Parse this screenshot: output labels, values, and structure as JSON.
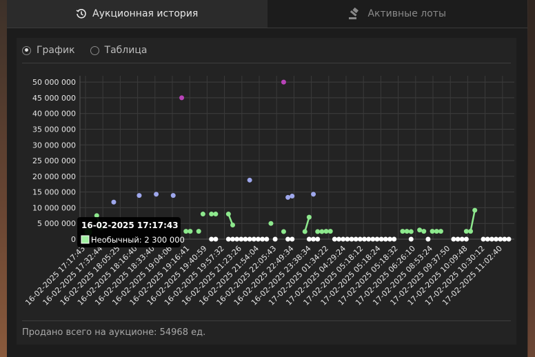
{
  "tabs": [
    {
      "label": "Аукционная история",
      "icon": "history-icon",
      "active": true
    },
    {
      "label": "Активные лоты",
      "icon": "gavel-icon",
      "active": false
    }
  ],
  "view_options": [
    {
      "label": "График",
      "selected": true
    },
    {
      "label": "Таблица",
      "selected": false
    }
  ],
  "footer": {
    "total_sold": "Продано всего на аукционе: 54968 ед."
  },
  "tooltip": {
    "title": "16-02-2025 17:17:43",
    "line": "Необычный: 2 300 000",
    "swatch_color": "#a0f0a0"
  },
  "colors": {
    "common": "#ffffff",
    "uncommon": "#8de88d",
    "rare": "#9ea7ec",
    "epic": "#b843b8"
  },
  "chart_data": {
    "type": "scatter",
    "title": "",
    "xlabel": "",
    "ylabel": "",
    "ylim": [
      0,
      52000000
    ],
    "yticks": [
      0,
      5000000,
      10000000,
      15000000,
      20000000,
      25000000,
      30000000,
      35000000,
      40000000,
      45000000,
      50000000
    ],
    "ytick_labels": [
      "0",
      "5 000 000",
      "10 000 000",
      "15 000 000",
      "20 000 000",
      "25 000 000",
      "30 000 000",
      "35 000 000",
      "40 000 000",
      "45 000 000",
      "50 000 000"
    ],
    "x_labels": [
      "16-02-2025 17:17:43",
      "16-02-2025 17:32:44",
      "16-02-2025 18:05:25",
      "16-02-2025 18:16:40",
      "16-02-2025 18:33:40",
      "16-02-2025 19:04:06",
      "16-02-2025 19:16:41",
      "16-02-2025 19:40:59",
      "16-02-2025 19:57:32",
      "16-02-2025 21:23:26",
      "16-02-2025 21:54:04",
      "16-02-2025 22:05:43",
      "16-02-2025 22:49:34",
      "16-02-2025 23:38:34",
      "17-02-2025 01:34:22",
      "17-02-2025 04:29:24",
      "17-02-2025 05:18:12",
      "17-02-2025 05:18:24",
      "17-02-2025 05:18:32",
      "17-02-2025 06:26:10",
      "17-02-2025 08:53:24",
      "17-02-2025 09:37:50",
      "17-02-2025 10:09:48",
      "17-02-2025 10:30:12",
      "17-02-2025 11:02:40"
    ],
    "x_count": 100,
    "series": [
      {
        "key": "common",
        "color": "#ffffff",
        "points": [
          [
            1,
            0
          ],
          [
            29,
            0
          ],
          [
            30,
            0
          ],
          [
            33,
            0
          ],
          [
            34,
            0
          ],
          [
            35,
            0
          ],
          [
            36,
            0
          ],
          [
            37,
            0
          ],
          [
            38,
            0
          ],
          [
            39,
            0
          ],
          [
            40,
            0
          ],
          [
            41,
            0
          ],
          [
            42,
            0
          ],
          [
            44,
            0
          ],
          [
            47,
            0
          ],
          [
            48,
            0
          ],
          [
            52,
            0
          ],
          [
            53,
            0
          ],
          [
            54,
            0
          ],
          [
            58,
            0
          ],
          [
            59,
            0
          ],
          [
            60,
            0
          ],
          [
            61,
            0
          ],
          [
            62,
            0
          ],
          [
            63,
            0
          ],
          [
            64,
            0
          ],
          [
            65,
            0
          ],
          [
            66,
            0
          ],
          [
            67,
            0
          ],
          [
            68,
            0
          ],
          [
            69,
            0
          ],
          [
            70,
            0
          ],
          [
            71,
            0
          ],
          [
            72,
            0
          ],
          [
            76,
            0
          ],
          [
            80,
            0
          ],
          [
            86,
            0
          ],
          [
            87,
            0
          ],
          [
            88,
            0
          ],
          [
            89,
            0
          ],
          [
            93,
            0
          ],
          [
            94,
            0
          ],
          [
            95,
            0
          ],
          [
            96,
            0
          ],
          [
            97,
            0
          ],
          [
            98,
            0
          ],
          [
            99,
            0
          ]
        ]
      },
      {
        "key": "uncommon",
        "color": "#8de88d",
        "lines": [
          [
            [
              2,
              7500000
            ],
            [
              3,
              3600000
            ]
          ],
          [
            [
              33,
              8000000
            ],
            [
              34,
              4500000
            ]
          ],
          [
            [
              51,
              2400000
            ],
            [
              52,
              7000000
            ]
          ],
          [
            [
              90,
              2500000
            ],
            [
              91,
              9200000
            ]
          ]
        ],
        "points": [
          [
            0,
            2300000
          ],
          [
            2,
            7500000
          ],
          [
            3,
            3600000
          ],
          [
            23,
            2500000
          ],
          [
            24,
            2500000
          ],
          [
            26,
            2500000
          ],
          [
            27,
            8000000
          ],
          [
            29,
            8000000
          ],
          [
            30,
            8000000
          ],
          [
            33,
            8000000
          ],
          [
            34,
            4500000
          ],
          [
            43,
            5000000
          ],
          [
            46,
            2400000
          ],
          [
            51,
            2400000
          ],
          [
            52,
            7000000
          ],
          [
            54,
            2400000
          ],
          [
            55,
            2400000
          ],
          [
            56,
            2500000
          ],
          [
            57,
            2500000
          ],
          [
            74,
            2500000
          ],
          [
            75,
            2500000
          ],
          [
            76,
            2400000
          ],
          [
            78,
            2900000
          ],
          [
            79,
            2500000
          ],
          [
            81,
            2500000
          ],
          [
            82,
            2500000
          ],
          [
            83,
            2500000
          ],
          [
            89,
            2500000
          ],
          [
            90,
            2500000
          ],
          [
            91,
            9200000
          ]
        ]
      },
      {
        "key": "rare",
        "color": "#9ea7ec",
        "points": [
          [
            6,
            11800000
          ],
          [
            12,
            13900000
          ],
          [
            16,
            14300000
          ],
          [
            20,
            13900000
          ],
          [
            38,
            18800000
          ],
          [
            47,
            13300000
          ],
          [
            48,
            13700000
          ],
          [
            53,
            14300000
          ]
        ]
      },
      {
        "key": "epic",
        "color": "#b843b8",
        "points": [
          [
            22,
            45000000
          ],
          [
            46,
            50000000
          ]
        ]
      }
    ]
  }
}
